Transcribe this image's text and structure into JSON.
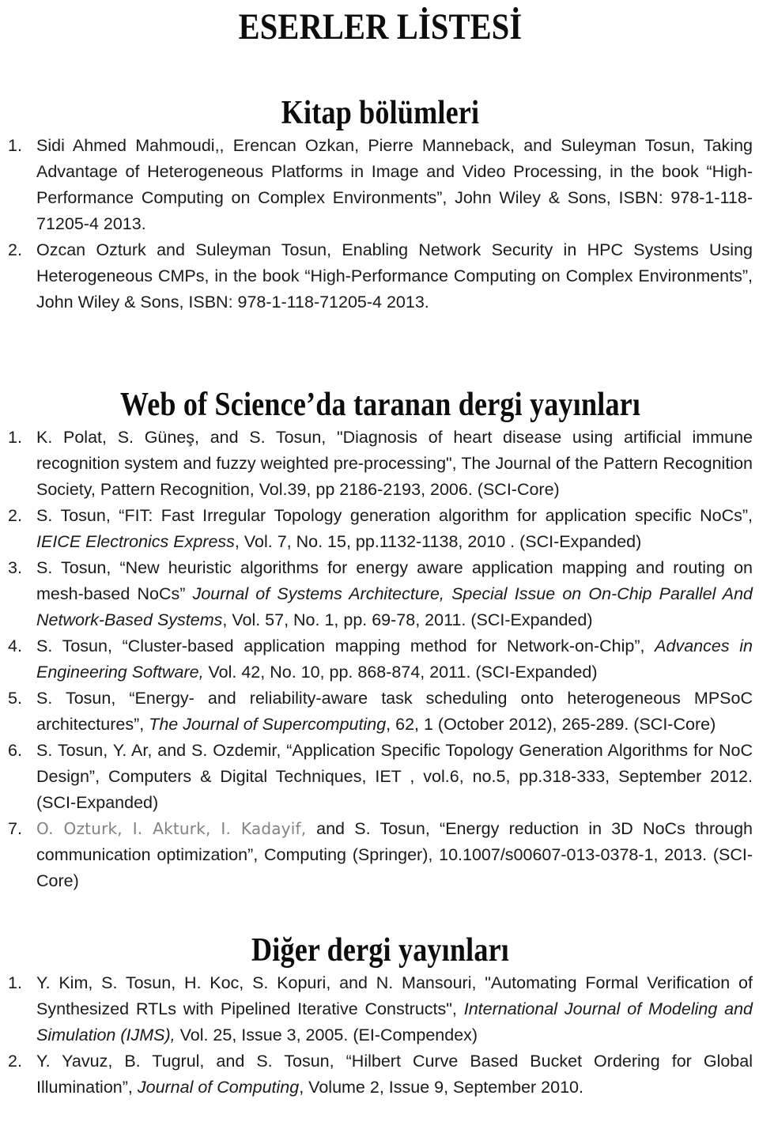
{
  "document": {
    "title": "ESERLER LİSTESİ",
    "sections": [
      {
        "heading": "Kitap bölümleri",
        "items": [
          {
            "number": "1.",
            "text": "Sidi Ahmed Mahmoudi,, Erencan Ozkan, Pierre Manneback, and Suleyman Tosun, Taking Advantage of Heterogeneous Platforms in Image and Video Processing, in the book “High-Performance Computing on Complex Environments”,  John Wiley & Sons, ISBN: 978-1-118-71205-4 2013."
          },
          {
            "number": "2.",
            "text": "Ozcan Ozturk and Suleyman Tosun, Enabling Network Security in HPC Systems Using Heterogeneous CMPs, in the book “High-Performance Computing on Complex Environments”, John Wiley & Sons, ISBN: 978-1-118-71205-4 2013."
          }
        ]
      },
      {
        "heading": "Web of Science’da taranan dergi yayınları",
        "items": [
          {
            "number": "1.",
            "text": "K. Polat, S. Güneş, and S. Tosun, \"Diagnosis of heart disease using artificial immune recognition system and fuzzy weighted pre-processing\", The Journal of the Pattern Recognition Society, Pattern Recognition, Vol.39, pp 2186-2193, 2006. (SCI-Core)"
          },
          {
            "number": "2.",
            "text_parts": [
              {
                "t": "S. Tosun, “FIT: Fast Irregular Topology generation algorithm for application specific NoCs”, ",
                "style": "normal"
              },
              {
                "t": "IEICE Electronics Express",
                "style": "italic"
              },
              {
                "t": ", Vol. 7, No. 15, pp.1132-1138, 2010 . (SCI-Expanded)",
                "style": "normal"
              }
            ]
          },
          {
            "number": "3.",
            "text_parts": [
              {
                "t": "S. Tosun, “New heuristic algorithms for energy aware application mapping and routing on mesh-based NoCs” ",
                "style": "normal"
              },
              {
                "t": "Journal of Systems Architecture, Special Issue on On-Chip Parallel And Network-Based Systems",
                "style": "italic"
              },
              {
                "t": ", Vol. 57, No. 1, pp. 69-78, 2011. (SCI-Expanded)",
                "style": "normal"
              }
            ]
          },
          {
            "number": "4.",
            "text_parts": [
              {
                "t": "S. Tosun, “Cluster-based application mapping method for Network-on-Chip”, ",
                "style": "normal"
              },
              {
                "t": "Advances in Engineering Software,",
                "style": "italic"
              },
              {
                "t": " Vol. 42, No. 10, pp. 868-874, 2011. (SCI-Expanded)",
                "style": "normal"
              }
            ]
          },
          {
            "number": "5.",
            "text_parts": [
              {
                "t": "S. Tosun, “Energy- and reliability-aware task scheduling onto heterogeneous MPSoC architectures”, ",
                "style": "normal"
              },
              {
                "t": "The Journal of Supercomputing",
                "style": "italic"
              },
              {
                "t": ", 62, 1 (October 2012), 265-289. (SCI-Core)",
                "style": "normal"
              }
            ]
          },
          {
            "number": "6.",
            "text": "S.  Tosun, Y. Ar, and S. Ozdemir, “Application Specific Topology Generation Algorithms for NoC Design”, Computers & Digital Techniques, IET , vol.6, no.5, pp.318-333, September 2012.  (SCI-Expanded)"
          },
          {
            "number": "7.",
            "text_parts": [
              {
                "t": "O. Ozturk, I. Akturk, I. Kadayif, ",
                "style": "gray"
              },
              {
                "t": "and S. Tosun, “Energy reduction in 3D NoCs through communication optimization”, Computing (Springer), 10.1007/s00607-013-0378-1, 2013. (SCI-Core)",
                "style": "normal"
              }
            ]
          }
        ]
      },
      {
        "heading": "Diğer dergi yayınları",
        "items": [
          {
            "number": "1.",
            "text_parts": [
              {
                "t": "Y. Kim, S. Tosun, H. Koc, S. Kopuri, and N. Mansouri, \"Automating Formal Verification of Synthesized RTLs with Pipelined Iterative Constructs\", ",
                "style": "normal"
              },
              {
                "t": "International Journal of Modeling and Simulation (IJMS),",
                "style": "italic"
              },
              {
                "t": " Vol. 25, Issue 3, 2005. (EI-Compendex)",
                "style": "normal"
              }
            ]
          },
          {
            "number": "2.",
            "text_parts": [
              {
                "t": "Y. Yavuz, B. Tugrul, and S. Tosun, “Hilbert Curve Based Bucket Ordering for Global Illumination”, ",
                "style": "normal"
              },
              {
                "t": "Journal of Computing",
                "style": "italic"
              },
              {
                "t": ", Volume 2, Issue 9, September 2010.",
                "style": "normal"
              }
            ]
          }
        ]
      }
    ]
  },
  "colors": {
    "text": "#1a1a1a",
    "heading": "#0d0d0d",
    "muted": "#808285",
    "background": "#ffffff"
  }
}
